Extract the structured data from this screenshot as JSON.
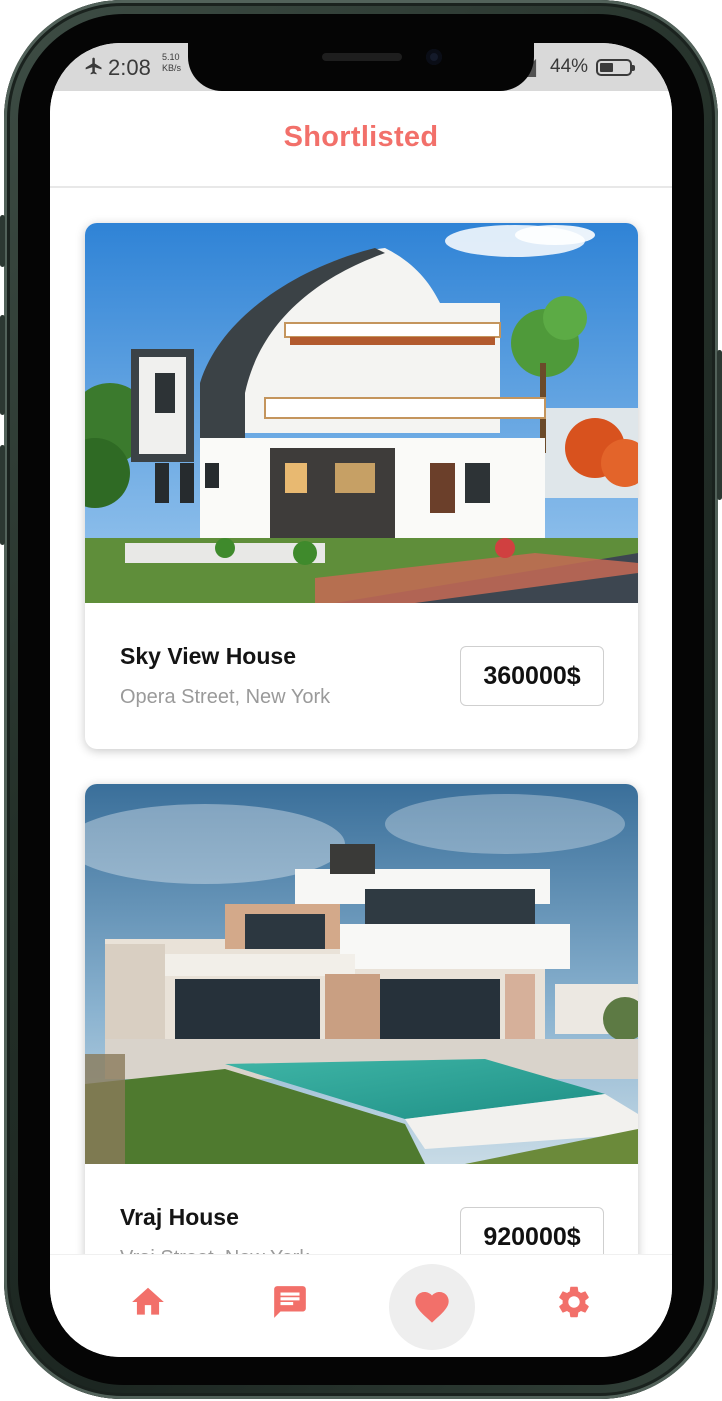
{
  "status_bar": {
    "time": "2:08",
    "speed_value": "5.10",
    "speed_unit": "KB/s",
    "battery": "44%"
  },
  "header": {
    "title": "Shortlisted"
  },
  "listings": [
    {
      "name": "Sky View House",
      "address": "Opera Street, New York",
      "price": "360000$"
    },
    {
      "name": "Vraj House",
      "address": "Vraj Street, New York",
      "price": "920000$"
    }
  ],
  "nav": {
    "items": [
      "home-icon",
      "chat-icon",
      "heart-icon",
      "settings-icon"
    ],
    "active": "heart-icon"
  },
  "colors": {
    "accent": "#f2706a",
    "nav_active_bg": "#eeeeee"
  }
}
